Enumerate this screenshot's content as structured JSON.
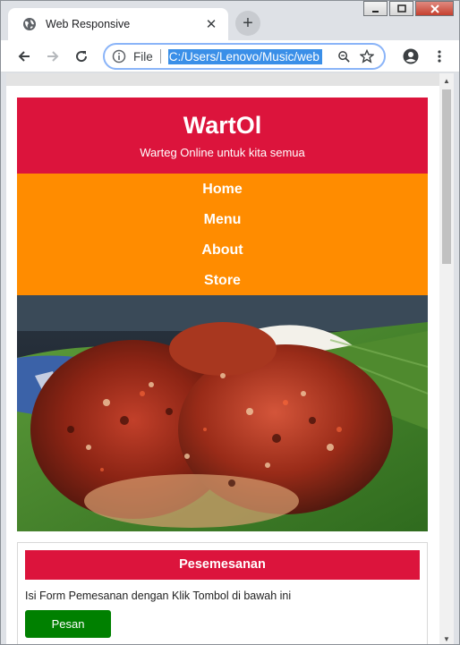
{
  "browser": {
    "tab_title": "Web Responsive",
    "tab_close": "✕",
    "new_tab": "+",
    "omnibox": {
      "info_label": "File",
      "url": "C:/Users/Lenovo/Music/web"
    }
  },
  "site": {
    "title": "WartOl",
    "tagline": "Warteg Online untuk kita semua",
    "nav": [
      "Home",
      "Menu",
      "About",
      "Store"
    ],
    "hero_image": "grilled-chicken-on-banana-leaf",
    "order": {
      "heading": "Pesemesanan",
      "text": "Isi Form Pemesanan dengan Klik Tombol di bawah ini",
      "button": "Pesan"
    }
  },
  "colors": {
    "header": "#dc143c",
    "nav": "#ff8c00",
    "button": "#008000",
    "omnibox_border": "#8ab4f8"
  }
}
